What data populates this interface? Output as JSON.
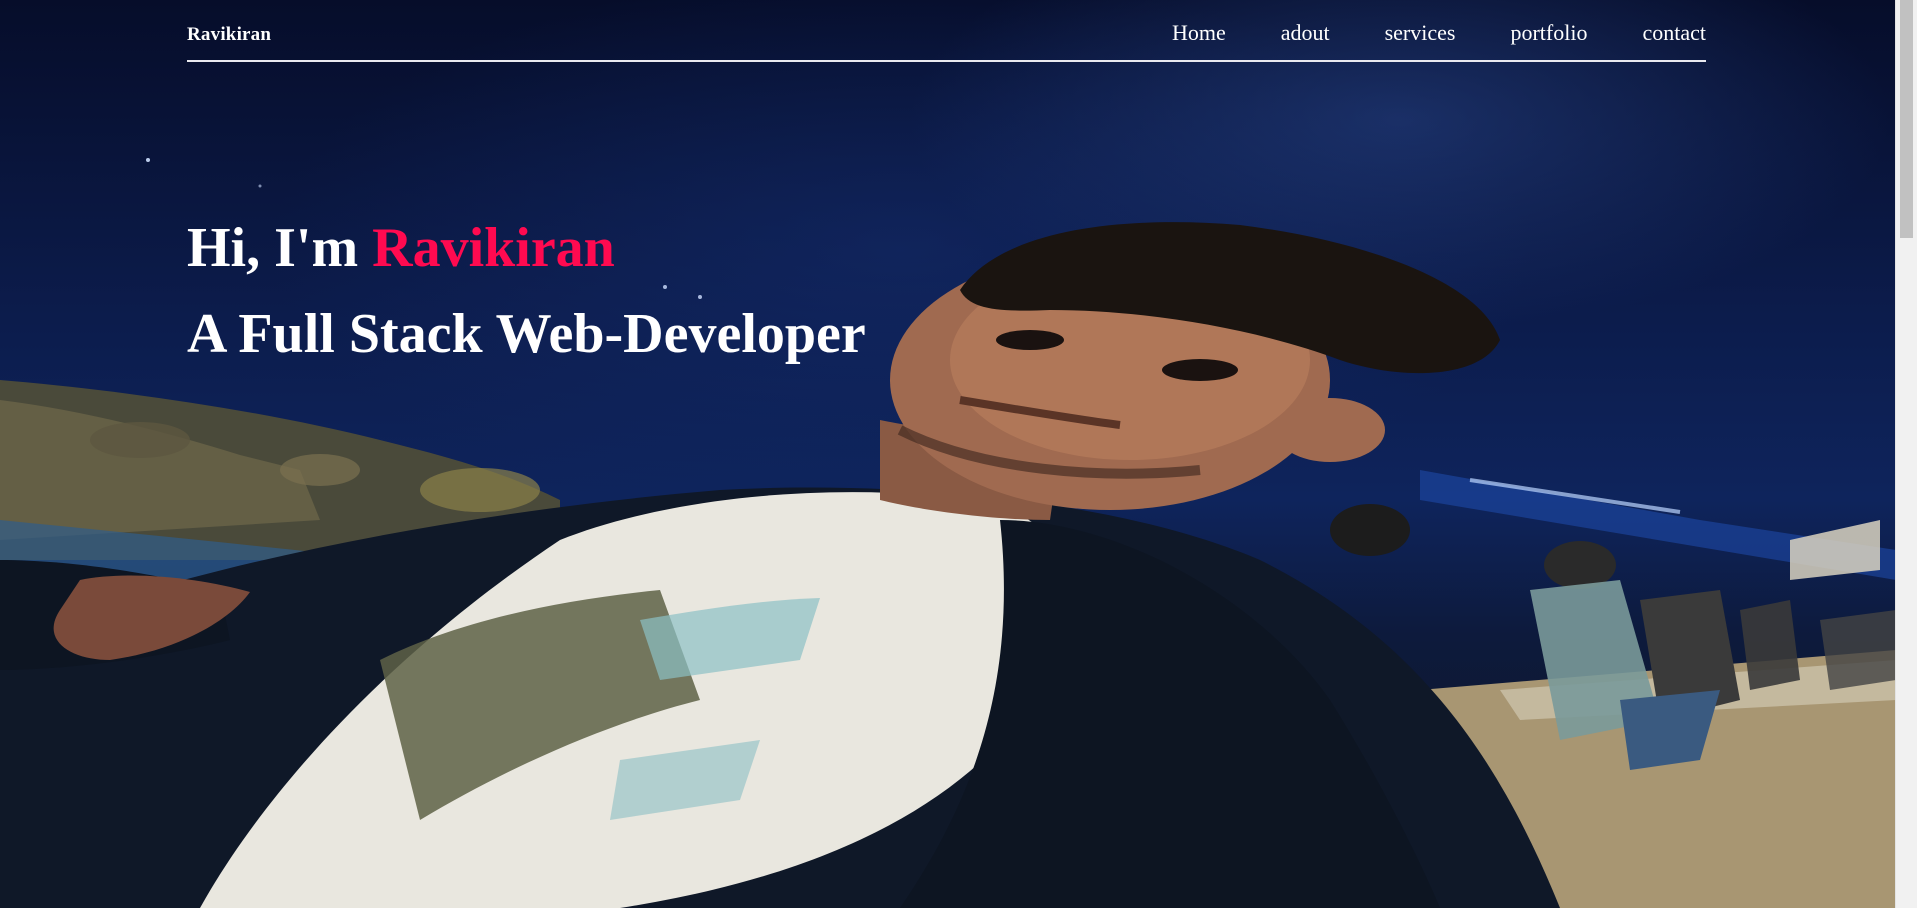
{
  "brand": {
    "name": "Ravikiran"
  },
  "nav": {
    "items": [
      {
        "label": "Home"
      },
      {
        "label": "adout"
      },
      {
        "label": "services"
      },
      {
        "label": "portfolio"
      },
      {
        "label": "contact"
      }
    ]
  },
  "hero": {
    "greeting": "Hi, I'm ",
    "name": "Ravikiran",
    "subtitle": "A Full Stack Web-Developer"
  },
  "colors": {
    "accent": "#ff0a50",
    "text": "#ffffff",
    "nav_rule": "#e9e9ef"
  },
  "icons": {
    "background": "hero-photo"
  }
}
